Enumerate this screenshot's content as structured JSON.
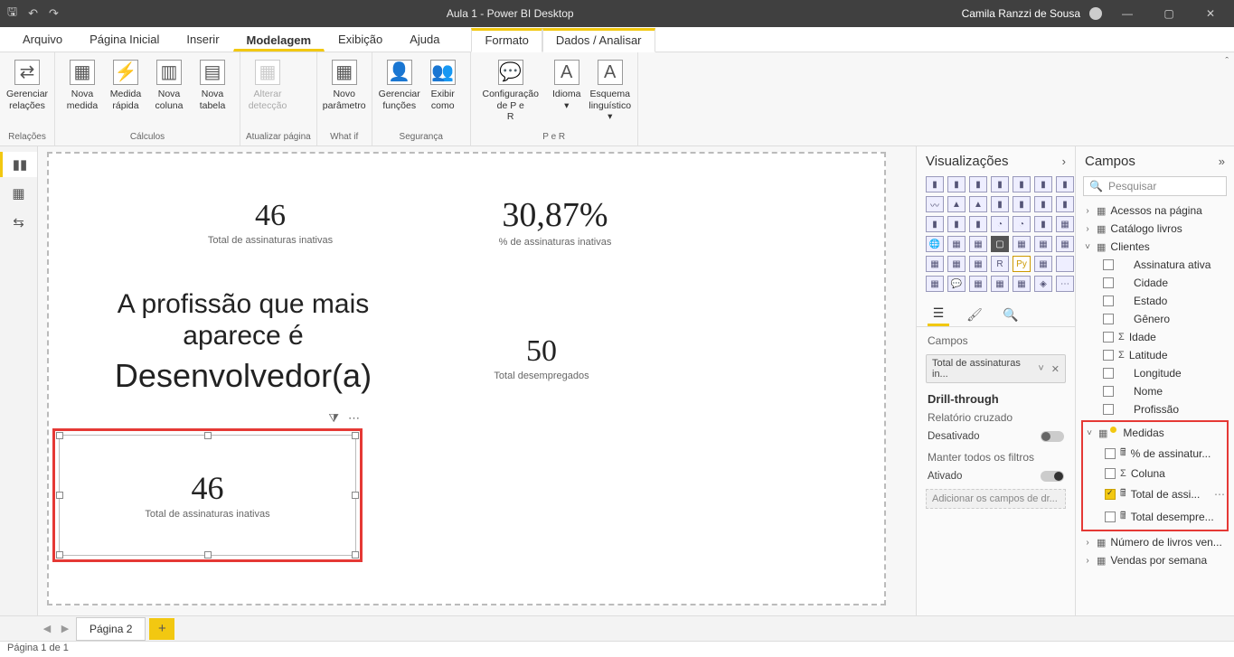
{
  "titlebar": {
    "title": "Aula 1 - Power BI Desktop",
    "user": "Camila Ranzzi de Sousa"
  },
  "menu": {
    "file": "Arquivo",
    "home": "Página Inicial",
    "insert": "Inserir",
    "modeling": "Modelagem",
    "view": "Exibição",
    "help": "Ajuda",
    "format": "Formato",
    "data": "Dados / Analisar"
  },
  "ribbon": {
    "groups": {
      "relations": {
        "label": "Relações",
        "manage": "Gerenciar\nrelações"
      },
      "calcs": {
        "label": "Cálculos",
        "newMeasure": "Nova\nmedida",
        "quickMeasure": "Medida\nrápida",
        "newColumn": "Nova\ncoluna",
        "newTable": "Nova\ntabela"
      },
      "refresh": {
        "label": "Atualizar página",
        "alter": "Alterar\ndetecção"
      },
      "whatif": {
        "label": "What if",
        "param": "Novo\nparâmetro"
      },
      "security": {
        "label": "Segurança",
        "manageRoles": "Gerenciar\nfunções",
        "viewAs": "Exibir\ncomo"
      },
      "qa": {
        "label": "P e R",
        "qaconfig": "Configuração de P e\nR",
        "lang": "Idioma\n▾",
        "schema": "Esquema\nlinguístico ▾"
      }
    }
  },
  "canvas": {
    "card1": {
      "value": "46",
      "label": "Total de assinaturas inativas"
    },
    "card2": {
      "value": "30,87%",
      "label": "% de assinaturas inativas"
    },
    "bigtext": {
      "line1": "A profissão que mais aparece é",
      "line2": "Desenvolvedor(a)"
    },
    "card3": {
      "value": "50",
      "label": "Total desempregados"
    },
    "selected": {
      "value": "46",
      "label": "Total de assinaturas inativas"
    }
  },
  "viz": {
    "title": "Visualizações",
    "fieldsHeader": "Campos",
    "pill": "Total de assinaturas in...",
    "drill": "Drill-through",
    "crossReport": "Relatório cruzado",
    "off": "Desativado",
    "keepFilters": "Manter todos os filtros",
    "on": "Ativado",
    "addDrill": "Adicionar os campos de dr..."
  },
  "fields": {
    "title": "Campos",
    "search": "Pesquisar",
    "tables": {
      "acessos": "Acessos na página",
      "catalogo": "Catálogo livros",
      "clientes": "Clientes",
      "clientesCols": {
        "assinatura": "Assinatura ativa",
        "cidade": "Cidade",
        "estado": "Estado",
        "genero": "Gênero",
        "idade": "Idade",
        "latitude": "Latitude",
        "longitude": "Longitude",
        "nome": "Nome",
        "profissao": "Profissão"
      },
      "medidas": "Medidas",
      "medidasCols": {
        "pct": "% de assinatur...",
        "coluna": "Coluna",
        "totalAssi": "Total de assi...",
        "totalDesemp": "Total desempre..."
      },
      "numLivros": "Número de livros ven...",
      "vendas": "Vendas por semana"
    }
  },
  "pagetabs": {
    "page": "Página 2"
  },
  "status": {
    "text": "Página 1 de 1"
  }
}
